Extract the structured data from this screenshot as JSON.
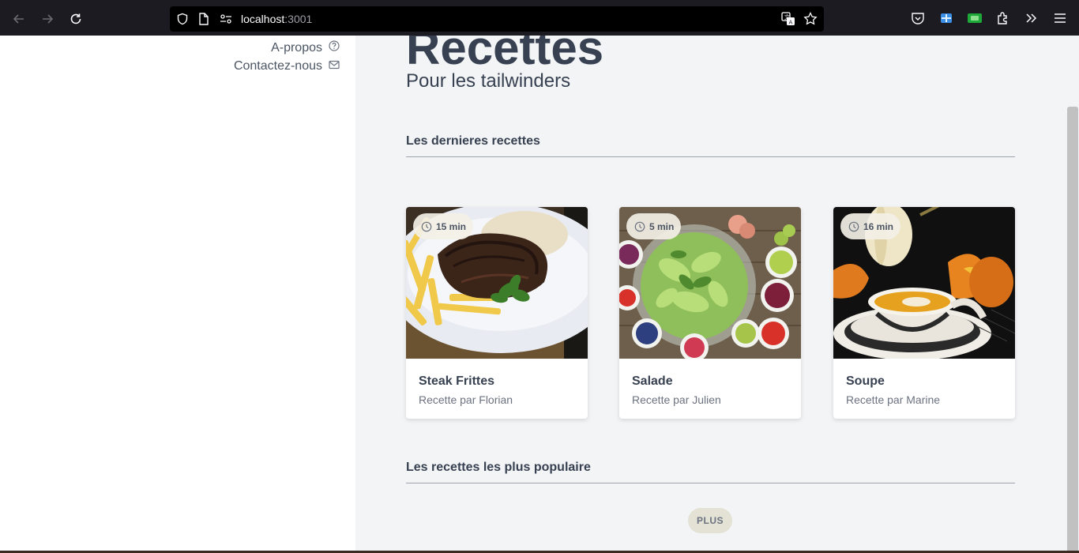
{
  "browser": {
    "url_host": "localhost",
    "url_port": ":3001",
    "icons": [
      "back-arrow-icon",
      "forward-arrow-icon",
      "reload-icon",
      "shield-icon",
      "page-icon",
      "connection-icon",
      "translate-icon",
      "bookmark-star-icon",
      "pocket-icon",
      "extension-blue-icon",
      "extension-green-icon",
      "extensions-puzzle-icon",
      "overflow-chevrons-icon",
      "menu-hamburger-icon"
    ]
  },
  "sidebar": {
    "links": [
      {
        "label": "A-propos",
        "icon": "help-circle-icon"
      },
      {
        "label": "Contactez-nous",
        "icon": "mail-icon"
      }
    ]
  },
  "main": {
    "title": "Recettes",
    "subtitle": "Pour les tailwinders",
    "latest_section": "Les dernieres recettes",
    "popular_section": "Les recettes les plus populaire",
    "more_button": "PLUS",
    "recipes": [
      {
        "name": "Steak Frittes",
        "author": "Recette par Florian",
        "time": "15 min",
        "image": "steak-fries-photo"
      },
      {
        "name": "Salade",
        "author": "Recette par Julien",
        "time": "5 min",
        "image": "salad-photo"
      },
      {
        "name": "Soupe",
        "author": "Recette par Marine",
        "time": "16 min",
        "image": "pumpkin-soup-photo"
      }
    ]
  },
  "colors": {
    "chrome_bg": "#1c1b22",
    "page_bg": "#f3f4f6",
    "sidebar_bg": "#ffffff",
    "heading": "#374151",
    "muted": "#6b7280",
    "badge_bg": "#f3f0e6",
    "plus_bg": "#e3e2d5"
  }
}
